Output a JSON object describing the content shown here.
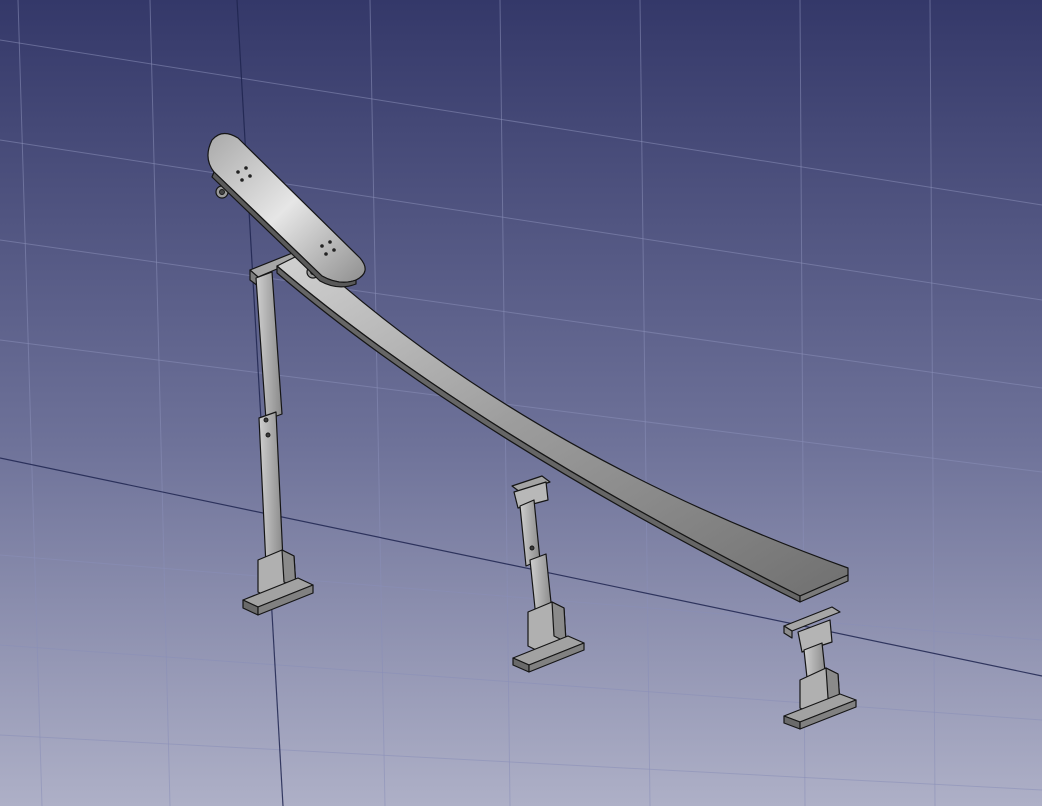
{
  "colors": {
    "background_top": "#343869",
    "background_bottom": "#aeb0c7",
    "grid": "#8a8fb8",
    "axis": "#1f2550",
    "part_light": "#b9b9b9",
    "part_mid": "#8e8e8e",
    "part_dark": "#5f5f5f",
    "edge": "#151515"
  },
  "scene": {
    "view_mode": "3d-cad-viewport",
    "objects": [
      "curved-ramp",
      "skateboard",
      "rear-support-leg",
      "middle-support-leg",
      "front-support-leg"
    ]
  }
}
